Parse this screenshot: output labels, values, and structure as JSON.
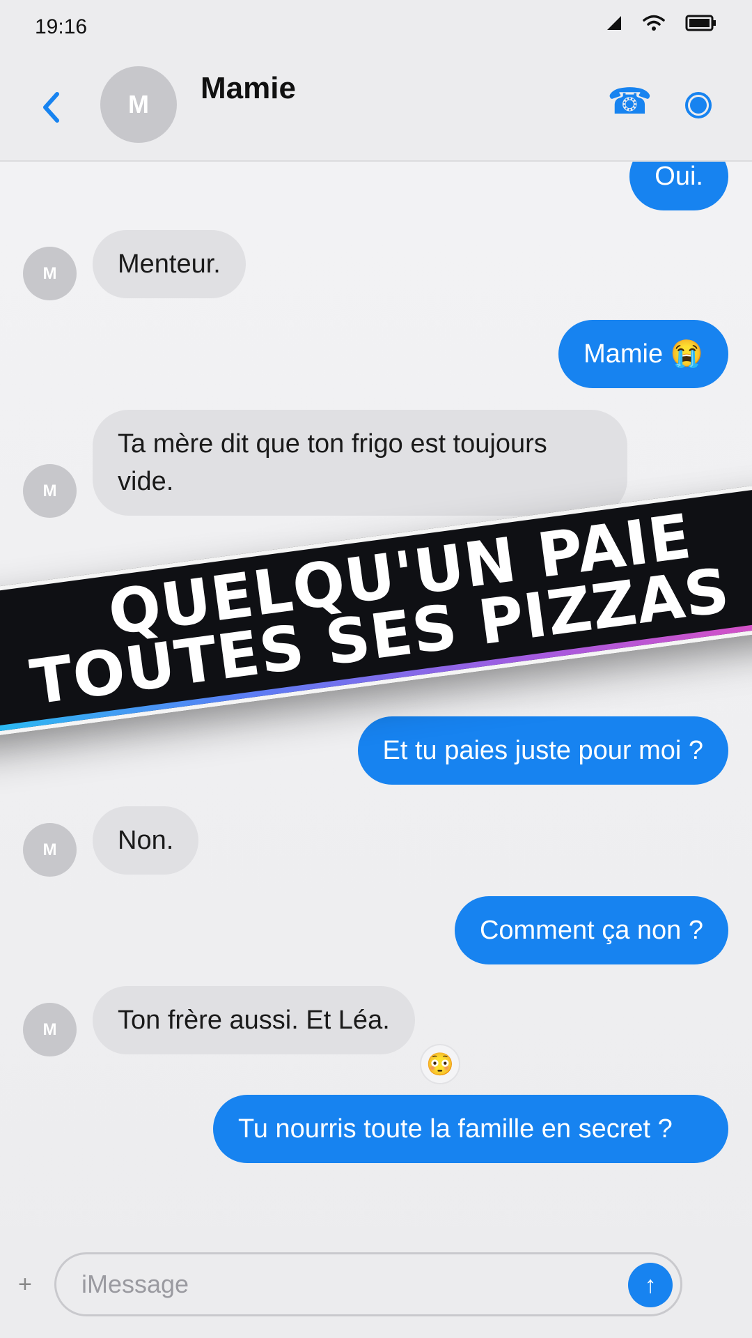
{
  "status_bar": {
    "time": "19:16",
    "icons": [
      "signal-icon",
      "wifi-icon",
      "battery-icon"
    ]
  },
  "header": {
    "avatar_initial": "M",
    "contact_name": "Mamie",
    "back_icon": "‹",
    "call_icon": "☎",
    "info_icon": "info-icon"
  },
  "messages": [
    {
      "sender": "me",
      "text": "Oui."
    },
    {
      "sender": "contact",
      "avatar": "M",
      "text": "Menteur."
    },
    {
      "sender": "me",
      "text": "Mamie 😭"
    },
    {
      "sender": "contact",
      "avatar": "M",
      "text": "Ta mère dit que ton frigo est toujours vide."
    },
    {
      "sender": "me",
      "text": "Et tu paies juste pour moi ?"
    },
    {
      "sender": "contact",
      "avatar": "M",
      "text": "Non."
    },
    {
      "sender": "me",
      "text": "Comment ça non ?"
    },
    {
      "sender": "contact",
      "avatar": "M",
      "text": "Ton frère aussi. Et Léa.",
      "reaction": "😳"
    },
    {
      "sender": "me",
      "text": "Tu nourris toute la famille en secret ?"
    }
  ],
  "banner": {
    "line1": "QUELQU'UN PAIE",
    "line2": "TOUTES SES PIZZAS"
  },
  "input_bar": {
    "plus_label": "+",
    "placeholder": "iMessage",
    "value": "",
    "send_icon": "↑"
  },
  "colors": {
    "accent_blue": "#1783f0",
    "incoming_bubble": "#e0e0e3",
    "background": "#efeff1",
    "banner_bg": "#0f1014"
  }
}
